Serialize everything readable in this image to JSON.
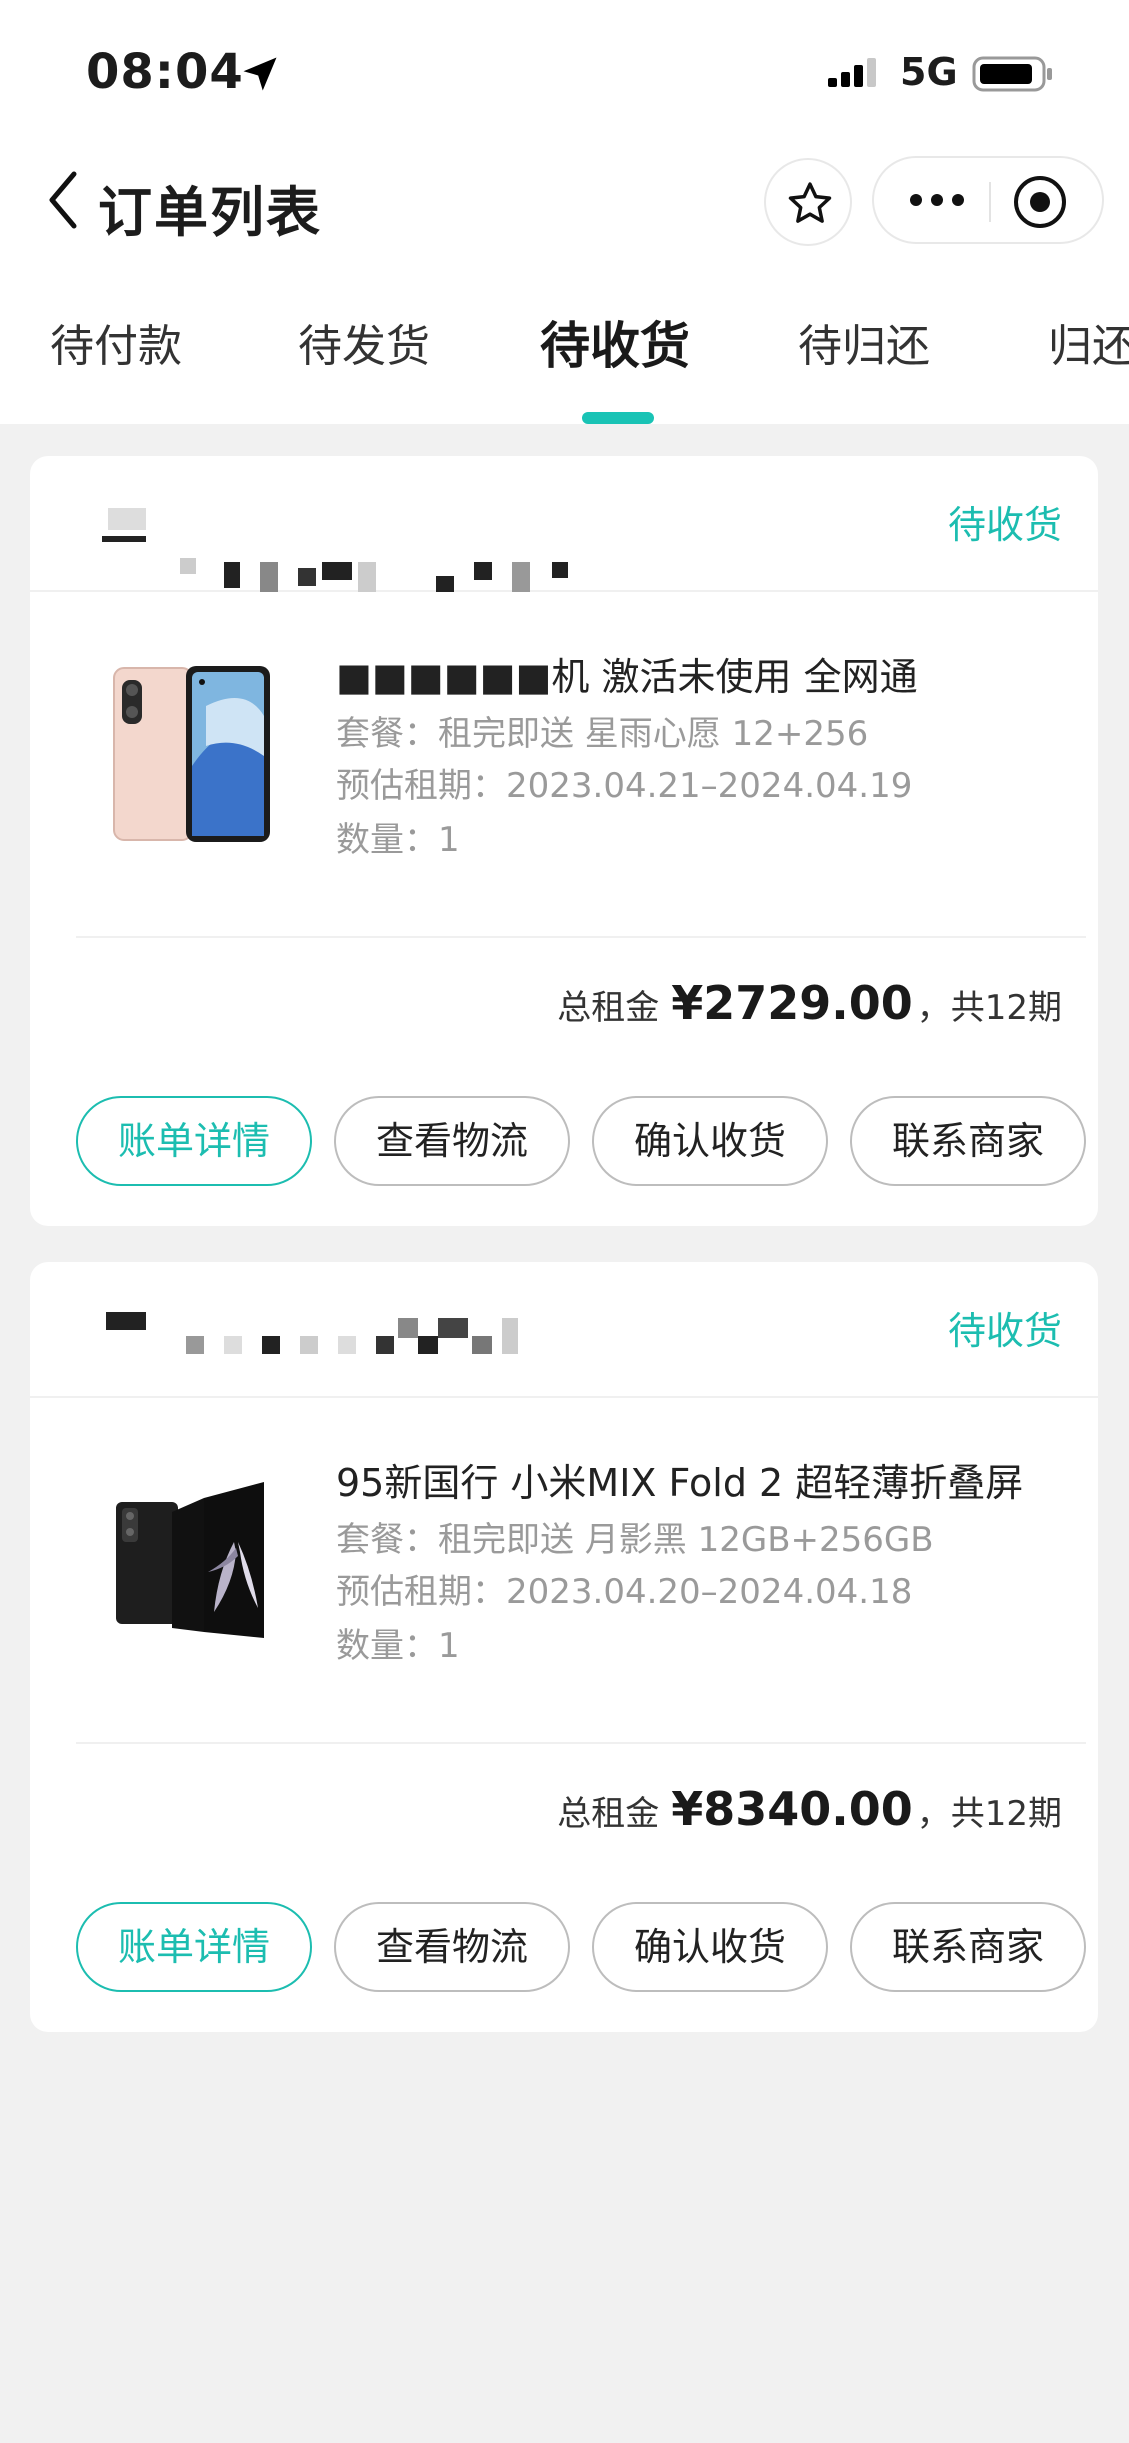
{
  "status_bar": {
    "time": "08:04",
    "network": "5G"
  },
  "nav": {
    "title": "订单列表"
  },
  "tabs": [
    {
      "label": "待付款"
    },
    {
      "label": "待发货"
    },
    {
      "label": "待收货",
      "active": true
    },
    {
      "label": "待归还"
    },
    {
      "label": "归还中"
    }
  ],
  "orders": [
    {
      "status": "待收货",
      "product_name": "■■■■■■机 激活未使用 全网通",
      "package": "套餐：租完即送 星雨心愿 12+256",
      "period": "预估租期：2023.04.21–2024.04.19",
      "quantity": "数量：1",
      "total_label": "总租金",
      "total_amount": "¥2729.00",
      "total_period": "，共12期",
      "buttons": {
        "bill": "账单详情",
        "logistics": "查看物流",
        "confirm": "确认收货",
        "contact": "联系商家"
      }
    },
    {
      "status": "待收货",
      "product_name": "95新国行 小米MIX Fold 2 超轻薄折叠屏",
      "package": "套餐：租完即送 月影黑 12GB+256GB",
      "period": "预估租期：2023.04.20–2024.04.18",
      "quantity": "数量：1",
      "total_label": "总租金",
      "total_amount": "¥8340.00",
      "total_period": "，共12期",
      "buttons": {
        "bill": "账单详情",
        "logistics": "查看物流",
        "confirm": "确认收货",
        "contact": "联系商家"
      }
    }
  ],
  "colors": {
    "accent": "#1cbdb0",
    "page_bg": "#f1f1f1"
  }
}
